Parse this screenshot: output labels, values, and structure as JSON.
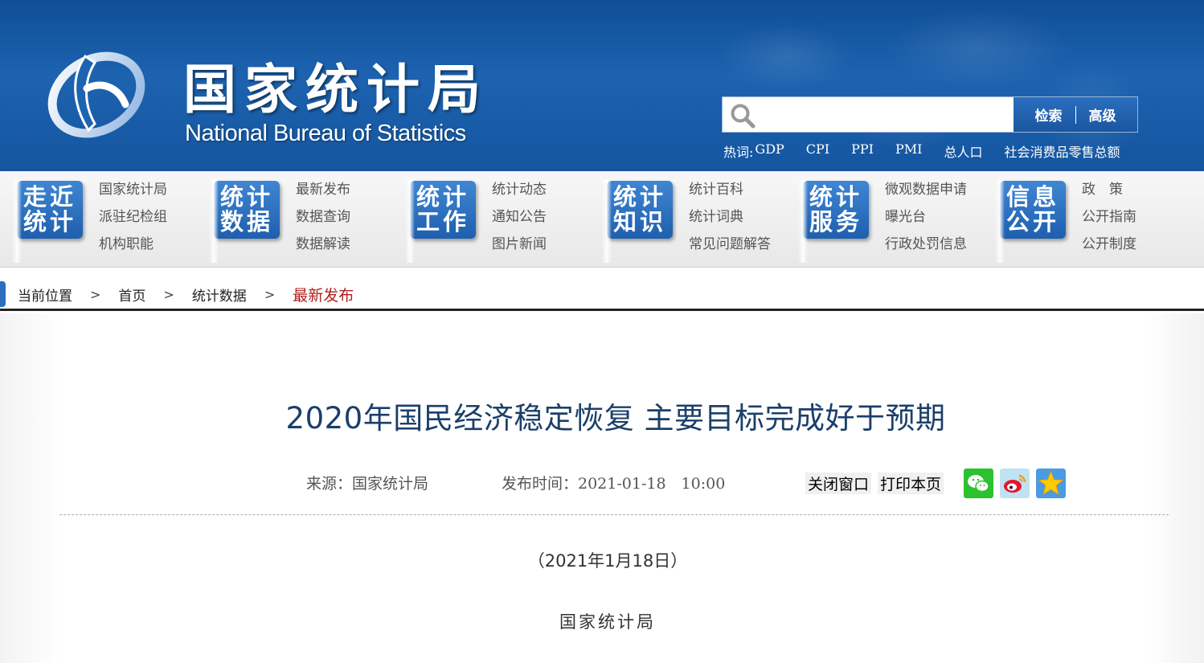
{
  "header": {
    "logo_cn": "国家统计局",
    "logo_en": "National Bureau of Statistics",
    "search": {
      "placeholder": "",
      "search_btn": "检索",
      "advanced_btn": "高级"
    },
    "hotwords_label": "热词:",
    "hotwords": [
      "GDP",
      "CPI",
      "PPI",
      "PMI",
      "总人口",
      "社会消费品零售总额"
    ]
  },
  "nav": [
    {
      "badge": [
        "走近",
        "统计"
      ],
      "links": [
        "国家统计局",
        "派驻纪检组",
        "机构职能"
      ]
    },
    {
      "badge": [
        "统计",
        "数据"
      ],
      "links": [
        "最新发布",
        "数据查询",
        "数据解读"
      ]
    },
    {
      "badge": [
        "统计",
        "工作"
      ],
      "links": [
        "统计动态",
        "通知公告",
        "图片新闻"
      ]
    },
    {
      "badge": [
        "统计",
        "知识"
      ],
      "links": [
        "统计百科",
        "统计词典",
        "常见问题解答"
      ]
    },
    {
      "badge": [
        "统计",
        "服务"
      ],
      "links": [
        "微观数据申请",
        "曝光台",
        "行政处罚信息"
      ]
    },
    {
      "badge": [
        "信息",
        "公开"
      ],
      "links": [
        "政　策",
        "公开指南",
        "公开制度"
      ]
    }
  ],
  "breadcrumb": {
    "label": "当前位置",
    "items": [
      "首页",
      "统计数据"
    ],
    "current": "最新发布",
    "separator": ">"
  },
  "article": {
    "title": "2020年国民经济稳定恢复 主要目标完成好于预期",
    "source": "来源：国家统计局",
    "publish_time": "发布时间：2021-01-18　10:00",
    "close_btn": "关闭窗口",
    "print_btn": "打印本页",
    "share_icons": [
      "wechat-icon",
      "weibo-icon",
      "qzone-icon"
    ],
    "date_line": "（2021年1月18日）",
    "author": "国家统计局"
  },
  "colors": {
    "header_blue": "#1d63b0",
    "title_blue": "#1b3f6a",
    "breadcrumb_current": "#b22020"
  }
}
